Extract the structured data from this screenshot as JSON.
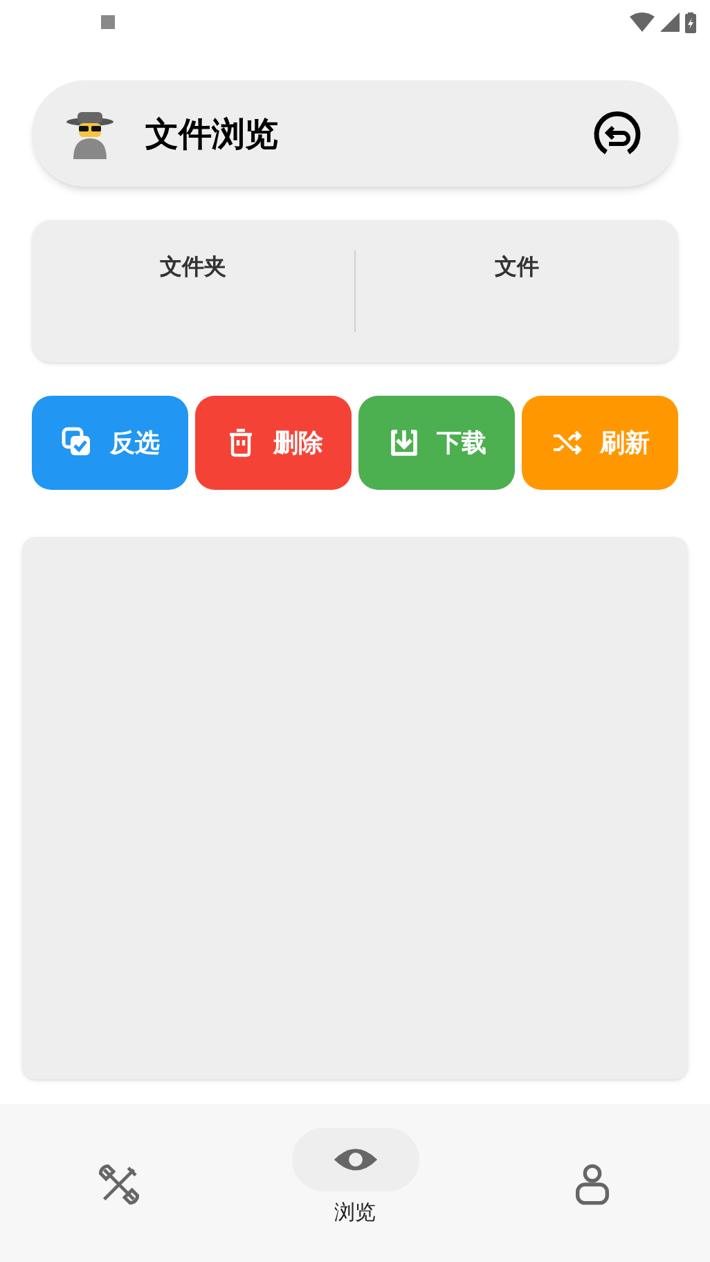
{
  "header": {
    "title": "文件浏览"
  },
  "columns": [
    "文件夹",
    "文件"
  ],
  "actions": [
    {
      "kind": "invert",
      "label": "反选",
      "color": "#2196f3"
    },
    {
      "kind": "delete",
      "label": "删除",
      "color": "#f44336"
    },
    {
      "kind": "download",
      "label": "下载",
      "color": "#4caf50"
    },
    {
      "kind": "refresh",
      "label": "刷新",
      "color": "#ff9800"
    }
  ],
  "nav": [
    {
      "kind": "tools",
      "selected": false
    },
    {
      "kind": "browse",
      "label": "浏览",
      "selected": true
    },
    {
      "kind": "profile",
      "selected": false
    }
  ]
}
